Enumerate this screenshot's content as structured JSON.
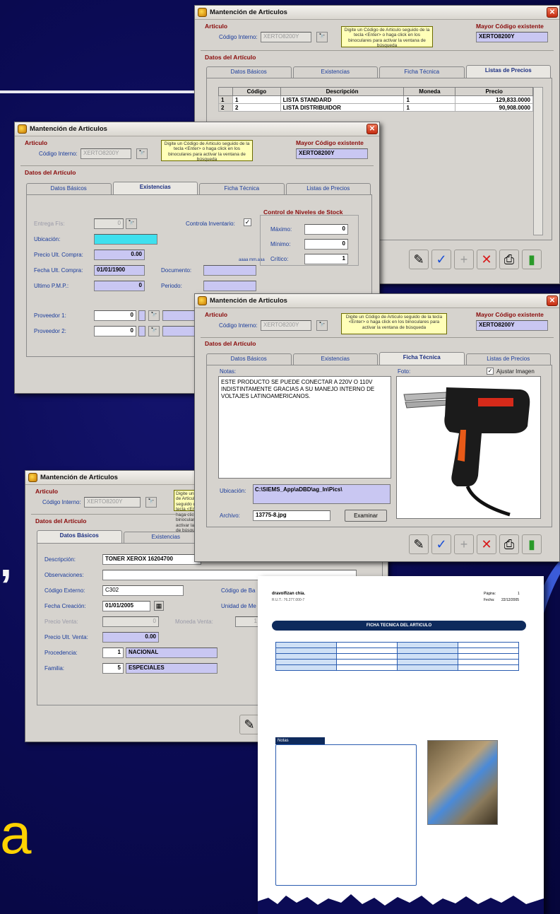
{
  "window_title": "Mantención de Articulos",
  "close_glyph": "✕",
  "common": {
    "section_articulo": "Articulo",
    "codigo_interno_label": "Código Interno:",
    "codigo_interno_value": "XERTO8200Y",
    "tooltip": "Digite un Código de Articulo seguido de la tecla <Enter> o haga click en los binoculares para activar la ventana de búsqueda",
    "mayor_codigo_label": "Mayor Código existente",
    "mayor_codigo_value": "XERTO8200Y",
    "datos_label": "Datos del Artículo",
    "tabs": [
      "Datos Básicos",
      "Existencias",
      "Ficha Técnica",
      "Listas de Precios"
    ],
    "binoculars": "🔭"
  },
  "win_precios": {
    "columns": [
      "Código",
      "Descripción",
      "Moneda",
      "Precio"
    ],
    "rows": [
      {
        "n": "1",
        "codigo": "1",
        "desc": "LISTA STANDARD",
        "moneda": "1",
        "precio": "129,833.0000"
      },
      {
        "n": "2",
        "codigo": "2",
        "desc": "LISTA DISTRIBUIDOR",
        "moneda": "1",
        "precio": "90,908.0000"
      }
    ]
  },
  "win_existencias": {
    "entrega_fis_label": "Entrega Fís:",
    "entrega_fis_value": "0",
    "ubicacion_label": "Ubicación:",
    "precio_ult_compra_label": "Precio Ult. Compra:",
    "precio_ult_compra_value": "0.00",
    "fecha_ult_compra_label": "Fecha Ult. Compra:",
    "fecha_ult_compra_value": "01/01/1900",
    "documento_label": "Documento:",
    "periodo_label": "Periodo:",
    "ultimo_pmp_label": "Ultimo P.M.P.:",
    "ultimo_pmp_value": "0",
    "fecha_hint": "aaaa mm.aaa",
    "controla_inventario_label": "Controla Inventario:",
    "stock_title": "Control de Niveles de Stock",
    "maximo_label": "Máximo:",
    "maximo_value": "0",
    "minimo_label": "Mínimo:",
    "minimo_value": "0",
    "critico_label": "Crítico:",
    "critico_value": "1",
    "proveedor1_label": "Proveedor 1:",
    "proveedor1_value": "0",
    "proveedor2_label": "Proveedor 2:",
    "proveedor2_value": "0"
  },
  "win_ficha": {
    "notas_label": "Notas:",
    "notas_text": "ESTE PRODUCTO SE PUEDE CONECTAR A 220V O 110V INDISTINTAMENTE GRACIAS A SU MANEJO INTERNO DE VOLTAJES LATINOAMERICANOS.",
    "foto_label": "Foto:",
    "ajustar_label": "Ajustar Imagen",
    "ubicacion_label": "Ubicación:",
    "ubicacion_value": "C:\\SIEMS_App\\aDBD\\ag_In\\Pics\\",
    "archivo_label": "Archivo:",
    "archivo_value": "13775-8.jpg",
    "examinar_label": "Examinar"
  },
  "win_basicos": {
    "descripcion_label": "Descripción:",
    "descripcion_value": "TONER XEROX 16204700",
    "observaciones_label": "Observaciones:",
    "codigo_externo_label": "Código Externo:",
    "codigo_externo_value": "C302",
    "codigo_barra_label": "Código de Ba",
    "fecha_creacion_label": "Fecha Creación:",
    "fecha_creacion_value": "01/01/2005",
    "unidad_medida_label": "Unidad de Me",
    "precio_venta_label": "Precio Venta:",
    "precio_venta_value": "0",
    "moneda_venta_label": "Moneda Venta:",
    "moneda_venta_value": "1",
    "precio_ult_venta_label": "Precio Ult. Venta:",
    "precio_ult_venta_value": "0.00",
    "procedencia_label": "Procedencia:",
    "procedencia_code": "1",
    "procedencia_value": "NACIONAL",
    "familia_label": "Familia:",
    "familia_code": "5",
    "familia_value": "ESPECIALES"
  },
  "report": {
    "company": "dravolfizan chia.",
    "sub": "R.U.T.: 76.277.000-7",
    "pagina_label": "Página:",
    "pagina_value": "1",
    "fecha_label": "Fecha:",
    "fecha_value": "22/12/2005",
    "title": "FICHA TECNICA DEL ARTICULO",
    "notes_title": "Notas"
  },
  "colors": {
    "background": "#0b0b55",
    "title_red": "#8a0b0b",
    "label_blue": "#1a3c9c",
    "field_lavender": "#c9c7f2",
    "field_cyan": "#3fe0ee",
    "tooltip_yellow": "#ffffb8",
    "accent_yellow": "#ffd200"
  }
}
